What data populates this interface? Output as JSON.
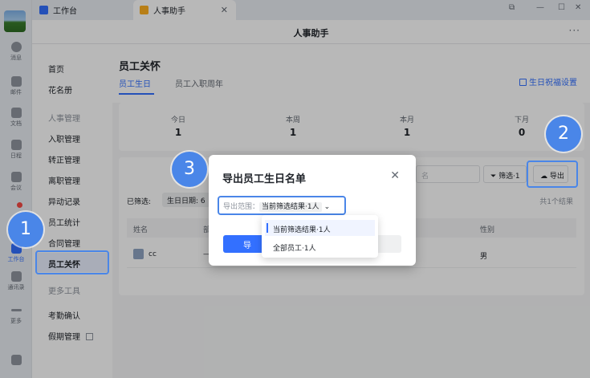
{
  "window": {
    "tabs": [
      {
        "label": "工作台"
      },
      {
        "label": "人事助手"
      }
    ]
  },
  "rail": {
    "items": [
      {
        "label": "消息"
      },
      {
        "label": "邮件"
      },
      {
        "label": "文档"
      },
      {
        "label": "日程"
      },
      {
        "label": "会议"
      },
      {
        "label": "工作台"
      },
      {
        "label": "通讯录"
      },
      {
        "label": "更多"
      }
    ]
  },
  "header": {
    "title": "人事助手",
    "more": "···"
  },
  "nav": {
    "home": "首页",
    "roster": "花名册",
    "group_hr": "人事管理",
    "onboarding": "入职管理",
    "regularization": "转正管理",
    "offboarding": "离职管理",
    "changes": "异动记录",
    "stats": "员工统计",
    "contracts": "合同管理",
    "care": "员工关怀",
    "group_tools": "更多工具",
    "attendance": "考勤确认",
    "leave": "假期管理"
  },
  "main": {
    "title": "员工关怀",
    "tabs": [
      "员工生日",
      "员工入职周年"
    ],
    "bless_settings": "生日祝福设置",
    "stats": [
      {
        "label": "今日",
        "value": "1"
      },
      {
        "label": "本周",
        "value": "1"
      },
      {
        "label": "本月",
        "value": "1"
      },
      {
        "label": "下月",
        "value": "0"
      }
    ],
    "search_placeholder": "名",
    "filter_label": "筛选·1",
    "export_label": "导出",
    "filtered_label": "已筛选:",
    "chip_label": "生日日期: 6",
    "total_label": "共1个结果",
    "columns": [
      "姓名",
      "部",
      "性别"
    ],
    "rows": [
      {
        "name": "cc",
        "dept": "—",
        "gender": "男"
      }
    ]
  },
  "dialog": {
    "title": "导出员工生日名单",
    "scope_label": "导出范围：",
    "scope_value": "当前筛选结果·1人",
    "confirm_label": "导",
    "options": [
      "当前筛选结果·1人",
      "全部员工·1人"
    ]
  },
  "callouts": [
    "1",
    "2",
    "3"
  ],
  "colors": {
    "accent": "#3370ff",
    "callout": "#4a86e8"
  }
}
